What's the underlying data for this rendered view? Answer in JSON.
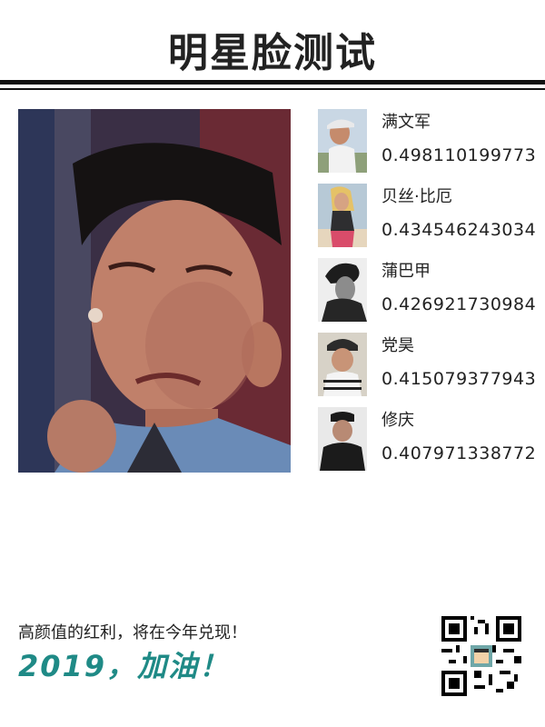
{
  "header": {
    "title": "明星脸测试"
  },
  "results": [
    {
      "name": "满文军",
      "score": "0.498110199773"
    },
    {
      "name": "贝丝·比厄",
      "score": "0.434546243034"
    },
    {
      "name": "蒲巴甲",
      "score": "0.426921730984"
    },
    {
      "name": "党昊",
      "score": "0.415079377943"
    },
    {
      "name": "修庆",
      "score": "0.407971338772"
    }
  ],
  "footer": {
    "tagline": "高颜值的红利，将在今年兑现！",
    "slogan": "2019，加油！"
  },
  "colors": {
    "accent": "#1f8a86",
    "rule": "#111111",
    "text": "#222222"
  },
  "icons": {
    "qr": "qr-code-icon"
  }
}
